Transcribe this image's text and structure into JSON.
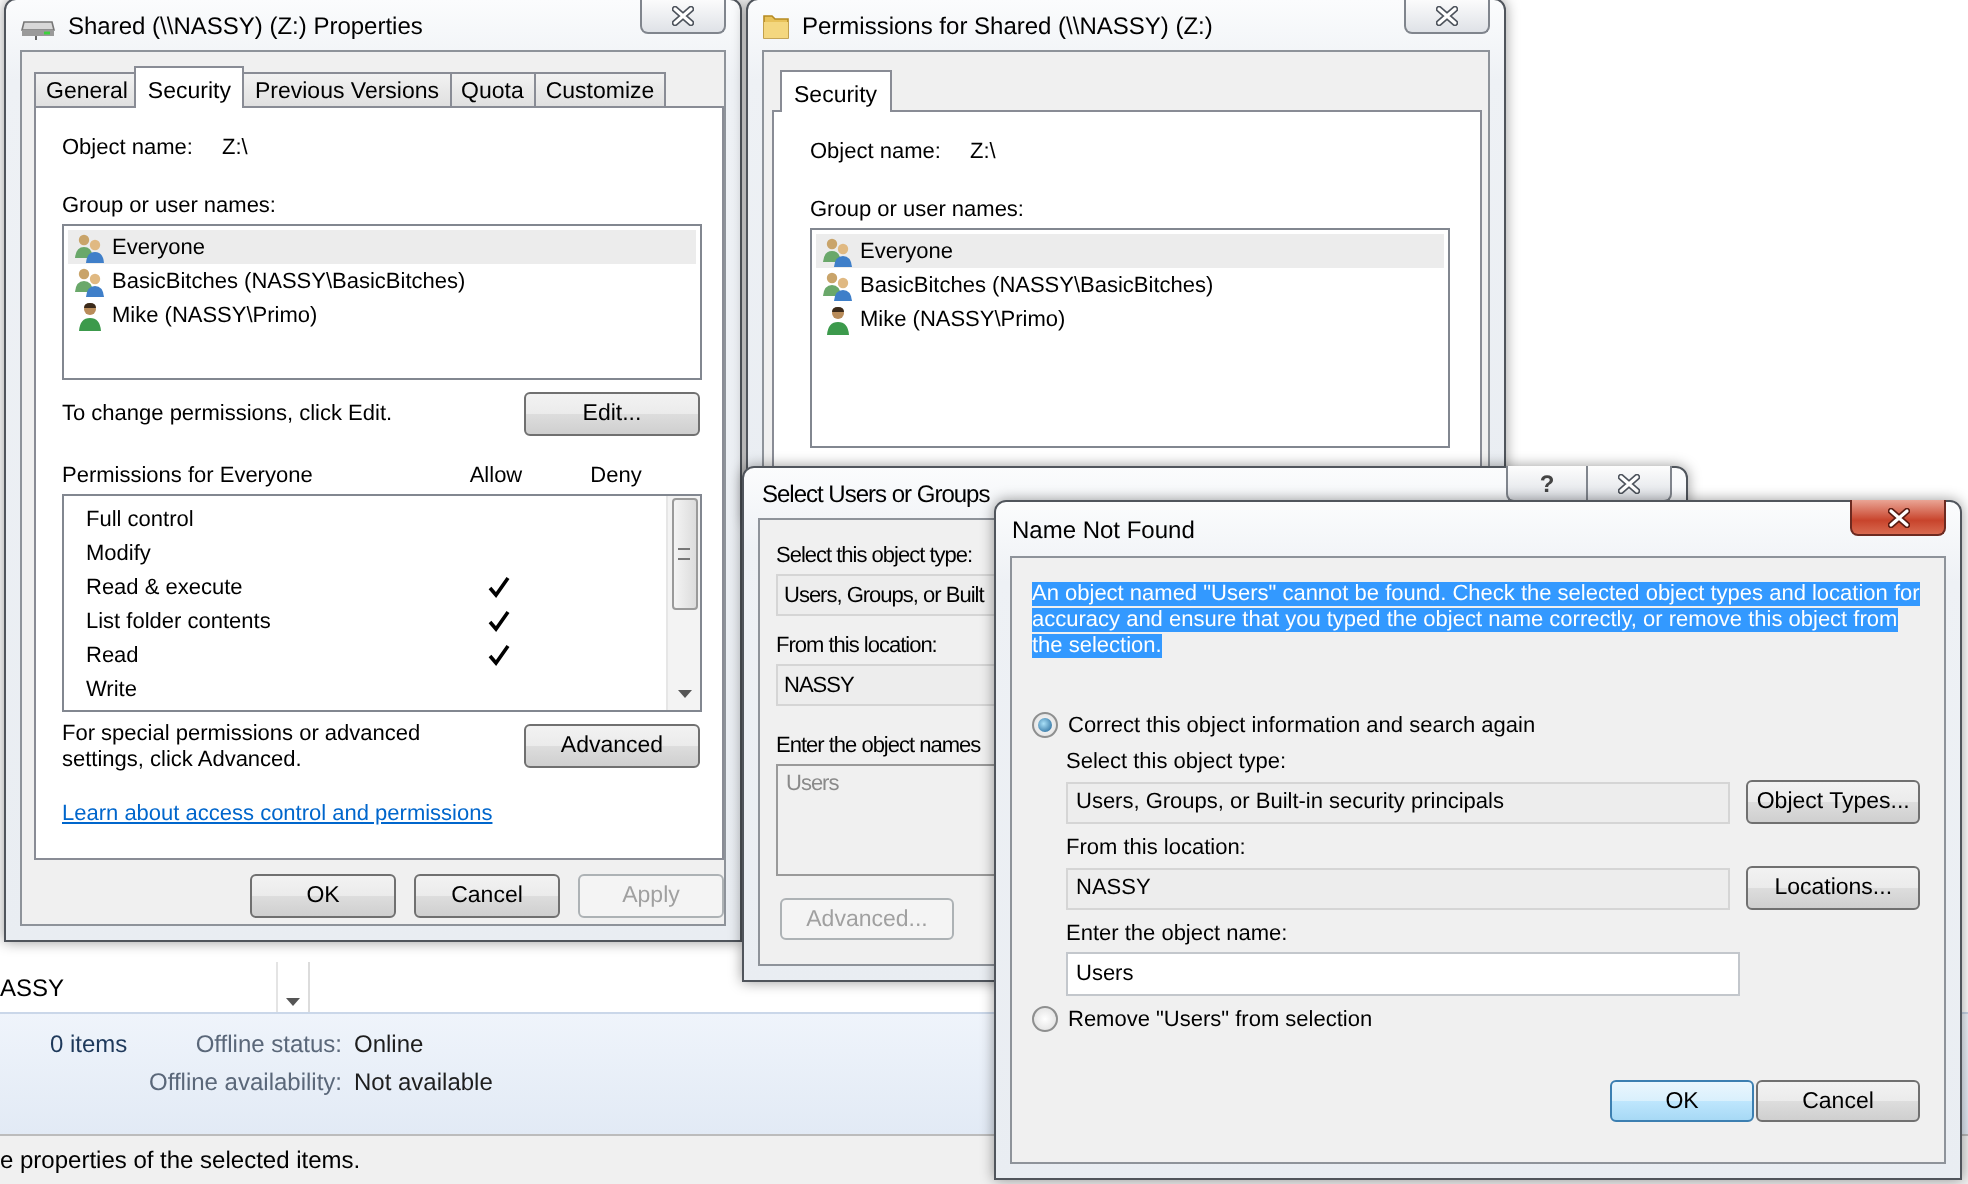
{
  "explorer": {
    "location_value": "ASSY",
    "item_count": "0 items",
    "details": [
      {
        "label": "Offline status:",
        "value": "Online"
      },
      {
        "label": "Offline availability:",
        "value": "Not available"
      }
    ],
    "status_bar": "e properties of the selected items."
  },
  "properties_window": {
    "title": "Shared (\\\\NASSY) (Z:) Properties",
    "tabs": [
      {
        "label": "General",
        "selected": false
      },
      {
        "label": "Security",
        "selected": true
      },
      {
        "label": "Previous Versions",
        "selected": false
      },
      {
        "label": "Quota",
        "selected": false
      },
      {
        "label": "Customize",
        "selected": false
      }
    ],
    "object_name_label": "Object name:",
    "object_name": "Z:\\",
    "users_label": "Group or user names:",
    "users": [
      {
        "name": "Everyone",
        "kind": "group",
        "selected": true
      },
      {
        "name": "BasicBitches (NASSY\\BasicBitches)",
        "kind": "group",
        "selected": false
      },
      {
        "name": "Mike (NASSY\\Primo)",
        "kind": "user",
        "selected": false
      }
    ],
    "change_hint": "To change permissions, click Edit.",
    "edit_button": "Edit...",
    "permissions_label": "Permissions for Everyone",
    "allow_header": "Allow",
    "deny_header": "Deny",
    "permissions": [
      {
        "name": "Full control",
        "allow": false,
        "deny": false
      },
      {
        "name": "Modify",
        "allow": false,
        "deny": false
      },
      {
        "name": "Read & execute",
        "allow": true,
        "deny": false
      },
      {
        "name": "List folder contents",
        "allow": true,
        "deny": false
      },
      {
        "name": "Read",
        "allow": true,
        "deny": false
      },
      {
        "name": "Write",
        "allow": false,
        "deny": false
      }
    ],
    "advanced_hint": "For special permissions or advanced settings, click Advanced.",
    "advanced_button": "Advanced",
    "link": "Learn about access control and permissions",
    "buttons": [
      {
        "label": "OK",
        "disabled": false
      },
      {
        "label": "Cancel",
        "disabled": false
      },
      {
        "label": "Apply",
        "disabled": true
      }
    ]
  },
  "permissions_window": {
    "title": "Permissions for Shared (\\\\NASSY) (Z:)",
    "tabs": [
      {
        "label": "Security",
        "selected": true
      }
    ],
    "object_name_label": "Object name:",
    "object_name": "Z:\\",
    "users_label": "Group or user names:",
    "users": [
      {
        "name": "Everyone",
        "kind": "group",
        "selected": true
      },
      {
        "name": "BasicBitches (NASSY\\BasicBitches)",
        "kind": "group",
        "selected": false
      },
      {
        "name": "Mike (NASSY\\Primo)",
        "kind": "user",
        "selected": false
      }
    ]
  },
  "select_users_window": {
    "title": "Select Users or Groups",
    "help_glyph": "?",
    "object_type_label": "Select this object type:",
    "object_type": "Users, Groups, or Built",
    "location_label": "From this location:",
    "location": "NASSY",
    "names_label": "Enter the object names",
    "names_value": "Users",
    "advanced_button": {
      "label": "Advanced...",
      "disabled": true
    }
  },
  "name_not_found_window": {
    "title": "Name Not Found",
    "message": "An object named \"Users\" cannot be found. Check the selected object types and location for accuracy and ensure that you typed the object name correctly, or remove this object from the selection.",
    "message_selected": true,
    "options": [
      {
        "label": "Correct this object information and search again",
        "selected": true,
        "fields": [
          {
            "label": "Select this object type:",
            "value": "Users, Groups, or Built-in security principals",
            "kind": "readonly",
            "button": "Object Types..."
          },
          {
            "label": "From this location:",
            "value": "NASSY",
            "kind": "readonly",
            "button": "Locations..."
          },
          {
            "label": "Enter the object name:",
            "value": "Users",
            "kind": "input"
          }
        ]
      },
      {
        "label": "Remove \"Users\" from selection",
        "selected": false
      }
    ],
    "buttons": [
      {
        "label": "OK",
        "default": true
      },
      {
        "label": "Cancel",
        "default": false
      }
    ]
  }
}
